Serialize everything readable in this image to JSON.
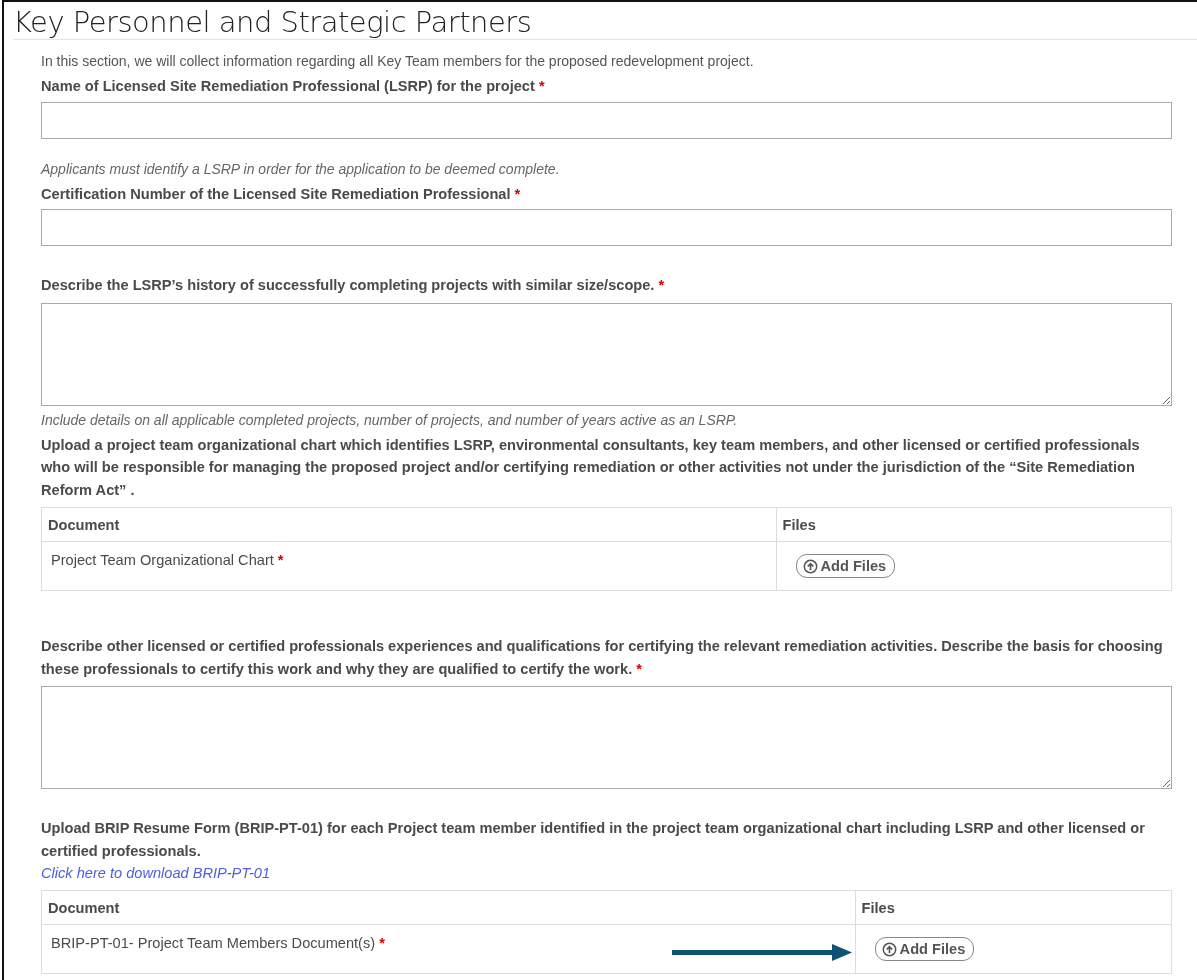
{
  "page": {
    "title": "Key Personnel and Strategic Partners"
  },
  "blocks": [
    {
      "kind": "intro",
      "text": "In this section, we will collect information regarding all Key Team members for the proposed redevelopment project."
    },
    {
      "kind": "label",
      "text": "Name of Licensed Site Remediation Professional (LSRP) for the project",
      "required_mark": "*"
    },
    {
      "kind": "input"
    },
    {
      "kind": "note",
      "text": "Applicants must identify a LSRP in order for the application to be deemed complete."
    },
    {
      "kind": "label",
      "text": "Certification Number of the Licensed Site Remediation Professional",
      "required_mark": "*"
    },
    {
      "kind": "input"
    },
    {
      "kind": "label",
      "text": "Describe the LSRP’s history of successfully completing projects with similar size/scope.",
      "required_mark": "*"
    },
    {
      "kind": "textarea"
    },
    {
      "kind": "note",
      "text": "Include details on all applicable completed projects, number of projects, and number of years active as an LSRP."
    },
    {
      "kind": "label",
      "text": "Upload a project team organizational chart which identifies LSRP, environmental consultants, key team members, and other licensed or certified professionals who will be responsible for managing the proposed project and/or certifying remediation or other activities not under the jurisdiction of the “Site Remediation Reform Act” ."
    },
    {
      "kind": "table",
      "columns": [
        "Document",
        "Files"
      ],
      "rows": [
        {
          "document": "Project Team Organizational Chart",
          "required_mark": "*",
          "button": "Add Files"
        }
      ]
    },
    {
      "kind": "label",
      "text": "Describe other licensed or certified professionals experiences and qualifications for certifying the relevant remediation activities. Describe the basis for choosing these professionals to certify this work and why they are qualified to certify the work.",
      "required_mark": "*"
    },
    {
      "kind": "textarea"
    },
    {
      "kind": "label",
      "text": "Upload BRIP Resume Form (BRIP-PT-01) for each Project team member identified in the project team organizational chart including LSRP and other licensed or certified professionals."
    },
    {
      "kind": "link",
      "text": "Click here to download BRIP-PT-01"
    },
    {
      "kind": "table",
      "columns": [
        "Document",
        "Files"
      ],
      "rows": [
        {
          "document": "BRIP-PT-01- Project Team Members Document(s)",
          "required_mark": "*",
          "button": "Add Files",
          "arrow": true
        }
      ]
    }
  ]
}
